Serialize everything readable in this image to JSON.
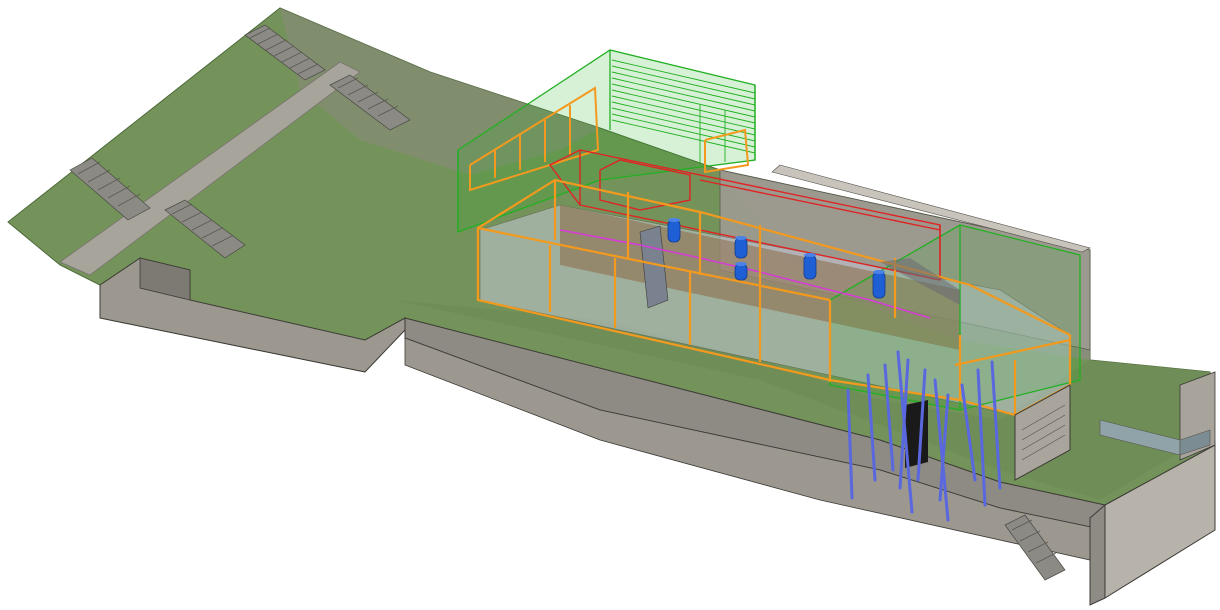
{
  "scene": {
    "colors": {
      "background": "#ffffff",
      "terrain": "#74935a",
      "terrain_dark": "#5f7e48",
      "concrete": "#9c9890",
      "concrete_dark": "#7d7a74",
      "concrete_light": "#b7b3ab",
      "stair": "#8c8a84",
      "path": "#a7a49b",
      "frame_orange": "#f39a1e",
      "frame_green": "#22b022",
      "frame_red": "#e02424",
      "frame_magenta": "#d63cd6",
      "tank_blue": "#1f5fd6",
      "pile_blue": "#5a68e0",
      "glass": "#c4c8d6",
      "wood": "#8a6a46",
      "outline": "#3c3a36"
    },
    "elements": [
      "terrain-slope",
      "stairways",
      "retaining-walls",
      "orange-structural-frame",
      "green-upper-volume",
      "red-service-frame",
      "blue-tanks",
      "blue-piles",
      "lower-entrance"
    ]
  }
}
